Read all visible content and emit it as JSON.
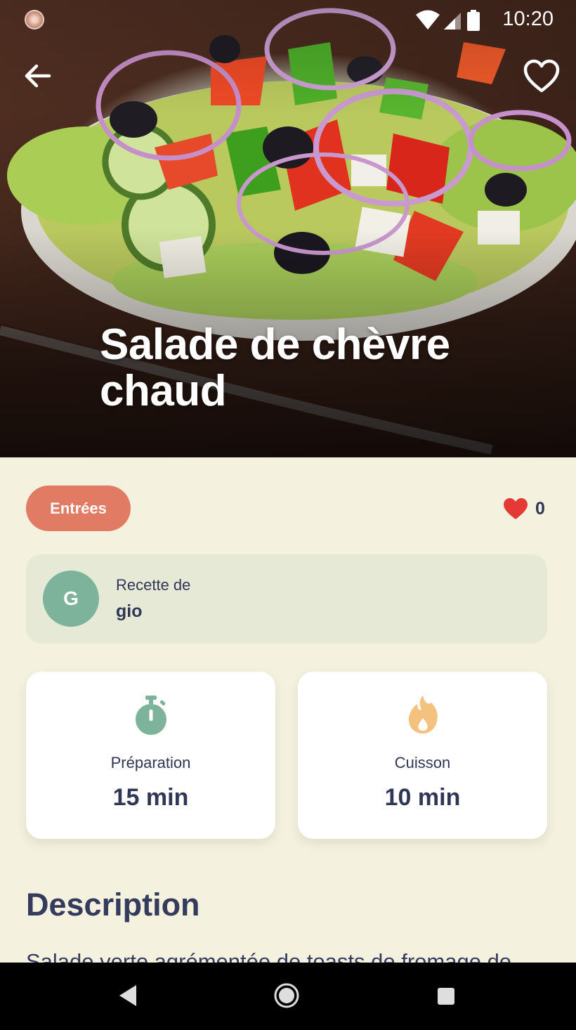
{
  "status_bar": {
    "time": "10:20",
    "icons": [
      "wifi-icon",
      "signal-icon",
      "battery-icon"
    ]
  },
  "header": {
    "back_icon": "arrow-left-icon",
    "favorite_icon": "heart-outline-icon"
  },
  "recipe": {
    "title_line1": "Salade de chèvre",
    "title_line2": "chaud",
    "category": "Entrées",
    "likes_count": "0"
  },
  "author": {
    "label": "Recette de",
    "initial": "G",
    "name": "gio"
  },
  "times": {
    "preparation_label": "Préparation",
    "preparation_value": "15 min",
    "cooking_label": "Cuisson",
    "cooking_value": "10 min"
  },
  "description": {
    "heading": "Description",
    "text": "Salade verte agrémentée de toasts de fromage de"
  },
  "colors": {
    "background": "#f4f1df",
    "chip": "#e27b64",
    "avatar": "#7eb39b",
    "card": "#e7e9d7",
    "text_dark": "#2f3656",
    "heart_red": "#e53935",
    "flame": "#f2c27e",
    "timer_green": "#7eb39b"
  }
}
